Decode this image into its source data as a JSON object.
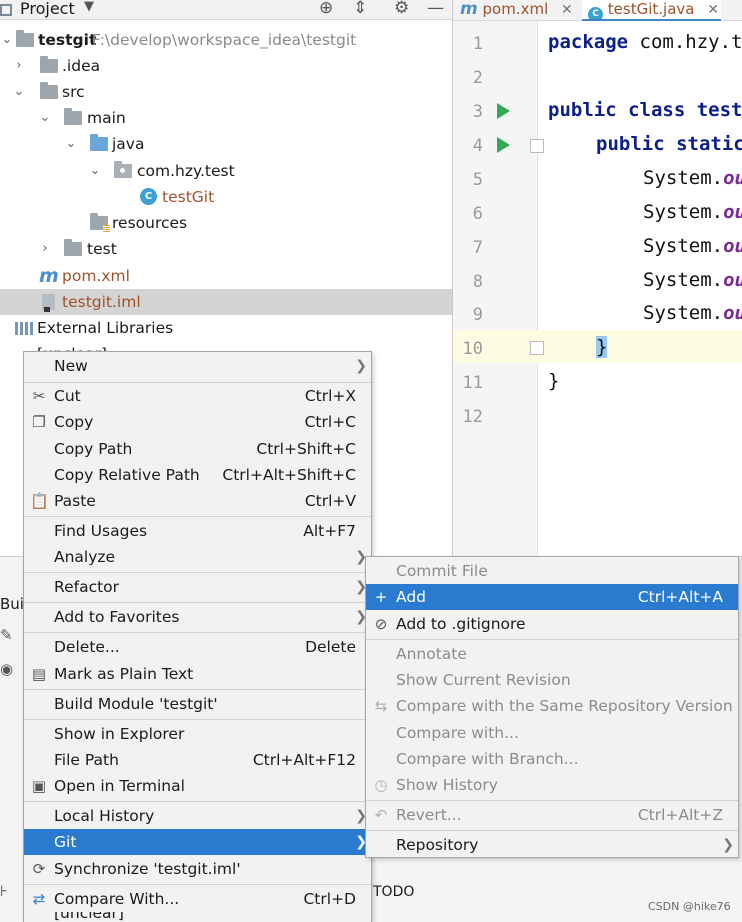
{
  "project_panel": {
    "title": "Project",
    "tree": [
      {
        "label": "testgit",
        "path": "F:\\develop\\workspace_idea\\testgit",
        "expanded": true
      },
      {
        "label": ".idea",
        "expanded": false
      },
      {
        "label": "src",
        "expanded": true
      },
      {
        "label": "main",
        "expanded": true
      },
      {
        "label": "java",
        "expanded": true
      },
      {
        "label": "com.hzy.test",
        "expanded": true
      },
      {
        "label": "testGit"
      },
      {
        "label": "resources"
      },
      {
        "label": "test",
        "expanded": false
      },
      {
        "label": "pom.xml"
      },
      {
        "label": "testgit.iml",
        "selected": true
      },
      {
        "label": "External Libraries"
      },
      {
        "label": "[unclear]"
      }
    ]
  },
  "editor": {
    "tabs": [
      {
        "label": "pom.xml",
        "active": false
      },
      {
        "label": "testGit.java",
        "active": true
      }
    ],
    "line_numbers": [
      "1",
      "2",
      "3",
      "4",
      "5",
      "6",
      "7",
      "8",
      "9",
      "10",
      "11",
      "12"
    ],
    "code": {
      "l1_kw": "package",
      "l1_rest": " com.hzy.t",
      "l3_kw": "public class",
      "l3_rest": " test",
      "l4_kw": "public static",
      "sys": "System.",
      "out": "ou",
      "brace_close": "}"
    }
  },
  "bottom": {
    "build": "Buil",
    "todo": "TODO",
    "watermark": "CSDN @hike76"
  },
  "context_menu": {
    "items": [
      {
        "label": "New",
        "shortcut": "",
        "submenu": true
      },
      {
        "label": "Cut",
        "shortcut": "Ctrl+X",
        "icon": "scissors-icon"
      },
      {
        "label": "Copy",
        "shortcut": "Ctrl+C",
        "icon": "copy-icon"
      },
      {
        "label": "Copy Path",
        "shortcut": "Ctrl+Shift+C"
      },
      {
        "label": "Copy Relative Path",
        "shortcut": "Ctrl+Alt+Shift+C"
      },
      {
        "label": "Paste",
        "shortcut": "Ctrl+V",
        "icon": "paste-icon"
      },
      {
        "label": "Find Usages",
        "shortcut": "Alt+F7"
      },
      {
        "label": "Analyze",
        "shortcut": "",
        "submenu": true
      },
      {
        "label": "Refactor",
        "shortcut": "",
        "submenu": true
      },
      {
        "label": "Add to Favorites",
        "shortcut": "",
        "submenu": true
      },
      {
        "label": "Delete...",
        "shortcut": "Delete"
      },
      {
        "label": "Mark as Plain Text",
        "shortcut": "",
        "icon": "plain-text-icon"
      },
      {
        "label": "Build Module 'testgit'",
        "shortcut": ""
      },
      {
        "label": "Show in Explorer",
        "shortcut": ""
      },
      {
        "label": "File Path",
        "shortcut": "Ctrl+Alt+F12"
      },
      {
        "label": "Open in Terminal",
        "shortcut": "",
        "icon": "terminal-icon"
      },
      {
        "label": "Local History",
        "shortcut": "",
        "submenu": true
      },
      {
        "label": "Git",
        "shortcut": "",
        "submenu": true,
        "active": true
      },
      {
        "label": "Synchronize 'testgit.iml'",
        "shortcut": "",
        "icon": "sync-icon"
      },
      {
        "label": "Compare With...",
        "shortcut": "Ctrl+D",
        "icon": "compare-icon"
      },
      {
        "label": "[unclear]",
        "shortcut": ""
      }
    ]
  },
  "git_submenu": {
    "items": [
      {
        "label": "Commit File",
        "shortcut": "",
        "disabled": true
      },
      {
        "label": "Add",
        "shortcut": "Ctrl+Alt+A",
        "active": true,
        "icon": "plus-icon"
      },
      {
        "label": "Add to .gitignore",
        "shortcut": "",
        "icon": "gitignore-icon"
      },
      {
        "label": "Annotate",
        "shortcut": "",
        "disabled": true
      },
      {
        "label": "Show Current Revision",
        "shortcut": "",
        "disabled": true
      },
      {
        "label": "Compare with the Same Repository Version",
        "shortcut": "",
        "disabled": true,
        "icon": "compare-arrows-icon"
      },
      {
        "label": "Compare with...",
        "shortcut": "",
        "disabled": true
      },
      {
        "label": "Compare with Branch...",
        "shortcut": "",
        "disabled": true
      },
      {
        "label": "Show History",
        "shortcut": "",
        "disabled": true,
        "icon": "clock-icon"
      },
      {
        "label": "Revert...",
        "shortcut": "Ctrl+Alt+Z",
        "disabled": true,
        "icon": "revert-icon"
      },
      {
        "label": "Repository",
        "shortcut": "",
        "submenu": true
      }
    ]
  },
  "colors": {
    "menu_highlight": "#2a7bd0",
    "selection_gray": "#d4d4d4",
    "keyword": "#0d1f8a",
    "static_field": "#7a2a96"
  }
}
